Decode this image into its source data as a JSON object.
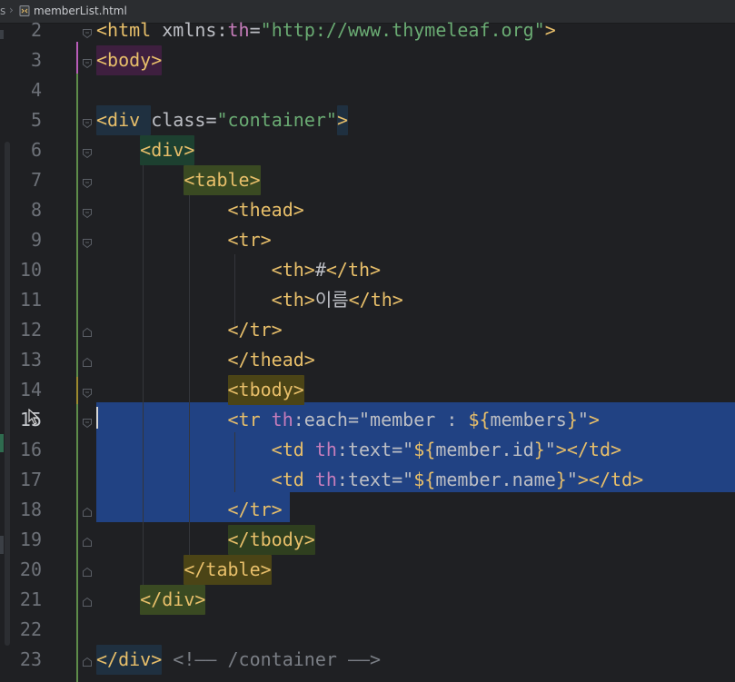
{
  "tab": {
    "prev_crumb": "s",
    "separator": "›",
    "file_name": "memberList.html"
  },
  "colors": {
    "background": "#1f2023",
    "selection": "#214283",
    "tag": "#e8bf6a",
    "attr": "#bcbec4",
    "string": "#6aab73",
    "th_prefix": "#c77dbb",
    "expr": "#e8bf6a",
    "comment": "#7a7e85"
  },
  "lines": [
    {
      "n": "2",
      "tokens": [
        [
          "<html ",
          "tag"
        ],
        [
          "xmlns",
          "attr"
        ],
        [
          ":",
          "plain"
        ],
        [
          "th",
          "th"
        ],
        [
          "=",
          "plain"
        ],
        [
          "\"http://www.thymeleaf.org\"",
          "string"
        ],
        [
          ">",
          "tag"
        ]
      ]
    },
    {
      "n": "3",
      "tokens": [
        [
          "<body>",
          "tag"
        ]
      ]
    },
    {
      "n": "4",
      "tokens": []
    },
    {
      "n": "5",
      "tokens": [
        [
          "<div ",
          "tag"
        ],
        [
          "class",
          "attr"
        ],
        [
          "=",
          "plain"
        ],
        [
          "\"container\"",
          "string"
        ],
        [
          ">",
          "tag"
        ]
      ]
    },
    {
      "n": "6",
      "tokens": [
        [
          "    ",
          "plain"
        ],
        [
          "<div>",
          "tag"
        ]
      ]
    },
    {
      "n": "7",
      "tokens": [
        [
          "        ",
          "plain"
        ],
        [
          "<table>",
          "tag"
        ]
      ]
    },
    {
      "n": "8",
      "tokens": [
        [
          "            ",
          "plain"
        ],
        [
          "<thead>",
          "tag"
        ]
      ]
    },
    {
      "n": "9",
      "tokens": [
        [
          "            ",
          "plain"
        ],
        [
          "<tr>",
          "tag"
        ]
      ]
    },
    {
      "n": "10",
      "tokens": [
        [
          "                ",
          "plain"
        ],
        [
          "<th>",
          "tag"
        ],
        [
          "#",
          "plain"
        ],
        [
          "</th>",
          "tag"
        ]
      ]
    },
    {
      "n": "11",
      "tokens": [
        [
          "                ",
          "plain"
        ],
        [
          "<th>",
          "tag"
        ],
        [
          "이름",
          "plain"
        ],
        [
          "</th>",
          "tag"
        ]
      ]
    },
    {
      "n": "12",
      "tokens": [
        [
          "            ",
          "plain"
        ],
        [
          "</tr>",
          "tag"
        ]
      ]
    },
    {
      "n": "13",
      "tokens": [
        [
          "            ",
          "plain"
        ],
        [
          "</thead>",
          "tag"
        ]
      ]
    },
    {
      "n": "14",
      "tokens": [
        [
          "            ",
          "plain"
        ],
        [
          "<tbody>",
          "tag"
        ]
      ]
    },
    {
      "n": "15",
      "tokens": [
        [
          "            ",
          "plain"
        ],
        [
          "<tr ",
          "tag"
        ],
        [
          "th",
          "th"
        ],
        [
          ":each=",
          "plain"
        ],
        [
          "\"member : ",
          "plainstr"
        ],
        [
          "${",
          "expr"
        ],
        [
          "members",
          "plainstr"
        ],
        [
          "}",
          "expr"
        ],
        [
          "\"",
          "plainstr"
        ],
        [
          ">",
          "tag"
        ]
      ]
    },
    {
      "n": "16",
      "tokens": [
        [
          "                ",
          "plain"
        ],
        [
          "<td ",
          "tag"
        ],
        [
          "th",
          "th"
        ],
        [
          ":text=",
          "plain"
        ],
        [
          "\"",
          "plainstr"
        ],
        [
          "${",
          "expr"
        ],
        [
          "member.id",
          "plainstr"
        ],
        [
          "}",
          "expr"
        ],
        [
          "\"",
          "plainstr"
        ],
        [
          "></td>",
          "tag"
        ]
      ]
    },
    {
      "n": "17",
      "tokens": [
        [
          "                ",
          "plain"
        ],
        [
          "<td ",
          "tag"
        ],
        [
          "th",
          "th"
        ],
        [
          ":text=",
          "plain"
        ],
        [
          "\"",
          "plainstr"
        ],
        [
          "${",
          "expr"
        ],
        [
          "member.name",
          "plainstr"
        ],
        [
          "}",
          "expr"
        ],
        [
          "\"",
          "plainstr"
        ],
        [
          "></td>",
          "tag"
        ]
      ]
    },
    {
      "n": "18",
      "tokens": [
        [
          "            ",
          "plain"
        ],
        [
          "</tr>",
          "tag"
        ]
      ]
    },
    {
      "n": "19",
      "tokens": [
        [
          "            ",
          "plain"
        ],
        [
          "</tbody>",
          "tag"
        ]
      ]
    },
    {
      "n": "20",
      "tokens": [
        [
          "        ",
          "plain"
        ],
        [
          "</table>",
          "tag"
        ]
      ]
    },
    {
      "n": "21",
      "tokens": [
        [
          "    ",
          "plain"
        ],
        [
          "</div>",
          "tag"
        ]
      ]
    },
    {
      "n": "22",
      "tokens": []
    },
    {
      "n": "23",
      "tokens": [
        [
          "</div>",
          "tag"
        ],
        [
          " ",
          "plain"
        ],
        [
          "<!—— /container ——>",
          "comment"
        ]
      ]
    }
  ]
}
